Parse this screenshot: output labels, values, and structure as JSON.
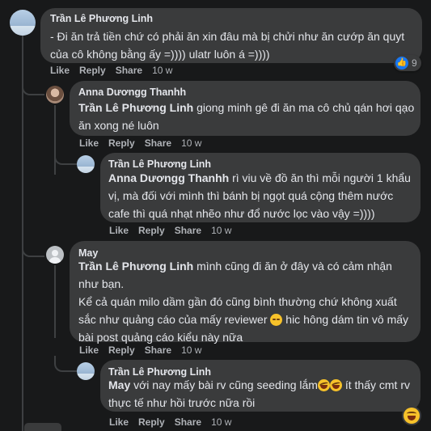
{
  "comments": [
    {
      "author": "Trần Lê Phương Linh",
      "text": "- Đi ăn trả tiền chứ có phải ăn xin đâu mà bị chửi như ăn cướp ăn quyt của cô không bằng ấy =)))) ulatr luôn á =))))",
      "actions": {
        "like": "Like",
        "reply": "Reply",
        "share": "Share",
        "time": "10 w"
      },
      "reaction_count": "9"
    },
    {
      "author": "Anna Dươngg Thanhh",
      "mention": "Trần Lê Phương Linh",
      "text": " giong minh gê đi ăn ma cô chủ qán hơi qạo ăn xong né luôn",
      "actions": {
        "like": "Like",
        "reply": "Reply",
        "share": "Share",
        "time": "10 w"
      }
    },
    {
      "author": "Trần Lê Phương Linh",
      "mention": "Anna Dươngg Thanhh",
      "text": " rì viu về đồ ăn thì mỗi người 1 khẩu vị, mà đối với mình thì bánh bị ngọt quá cộng thêm nước cafe thì quá nhạt nhẽo như đổ nước lọc vào vậy =))))",
      "actions": {
        "like": "Like",
        "reply": "Reply",
        "share": "Share",
        "time": "10 w"
      }
    },
    {
      "author": "May",
      "mention": "Trần Lê Phương Linh",
      "text": " mình cũng đi ăn ở đây và có cảm nhận như bạn.",
      "text2": "Kể cả quán milo dầm gần đó cũng bình thường chứ không xuất sắc như quảng cáo của mấy reviewer",
      "text3": " hic hông dám tin vô mấy bài post quảng cáo kiểu này nữa",
      "emoji": "sad-face-emoji",
      "actions": {
        "like": "Like",
        "reply": "Reply",
        "share": "Share",
        "time": "10 w"
      }
    },
    {
      "author": "Trần Lê Phương Linh",
      "mention": "May",
      "text": " với nay mấy bài rv cũng seeding lắm",
      "text2": " ít thấy cmt rv thực tế như hồi trước nữa rồi",
      "emoji": "rofl-emoji",
      "actions": {
        "like": "Like",
        "reply": "Reply",
        "share": "Share",
        "time": "10 w"
      },
      "reaction": "laugh-reaction"
    }
  ],
  "colors": {
    "background": "#18191a",
    "bubble": "#3a3b3c",
    "text": "#e4e6eb",
    "muted": "#b0b3b8",
    "like_blue": "#1877f2"
  }
}
